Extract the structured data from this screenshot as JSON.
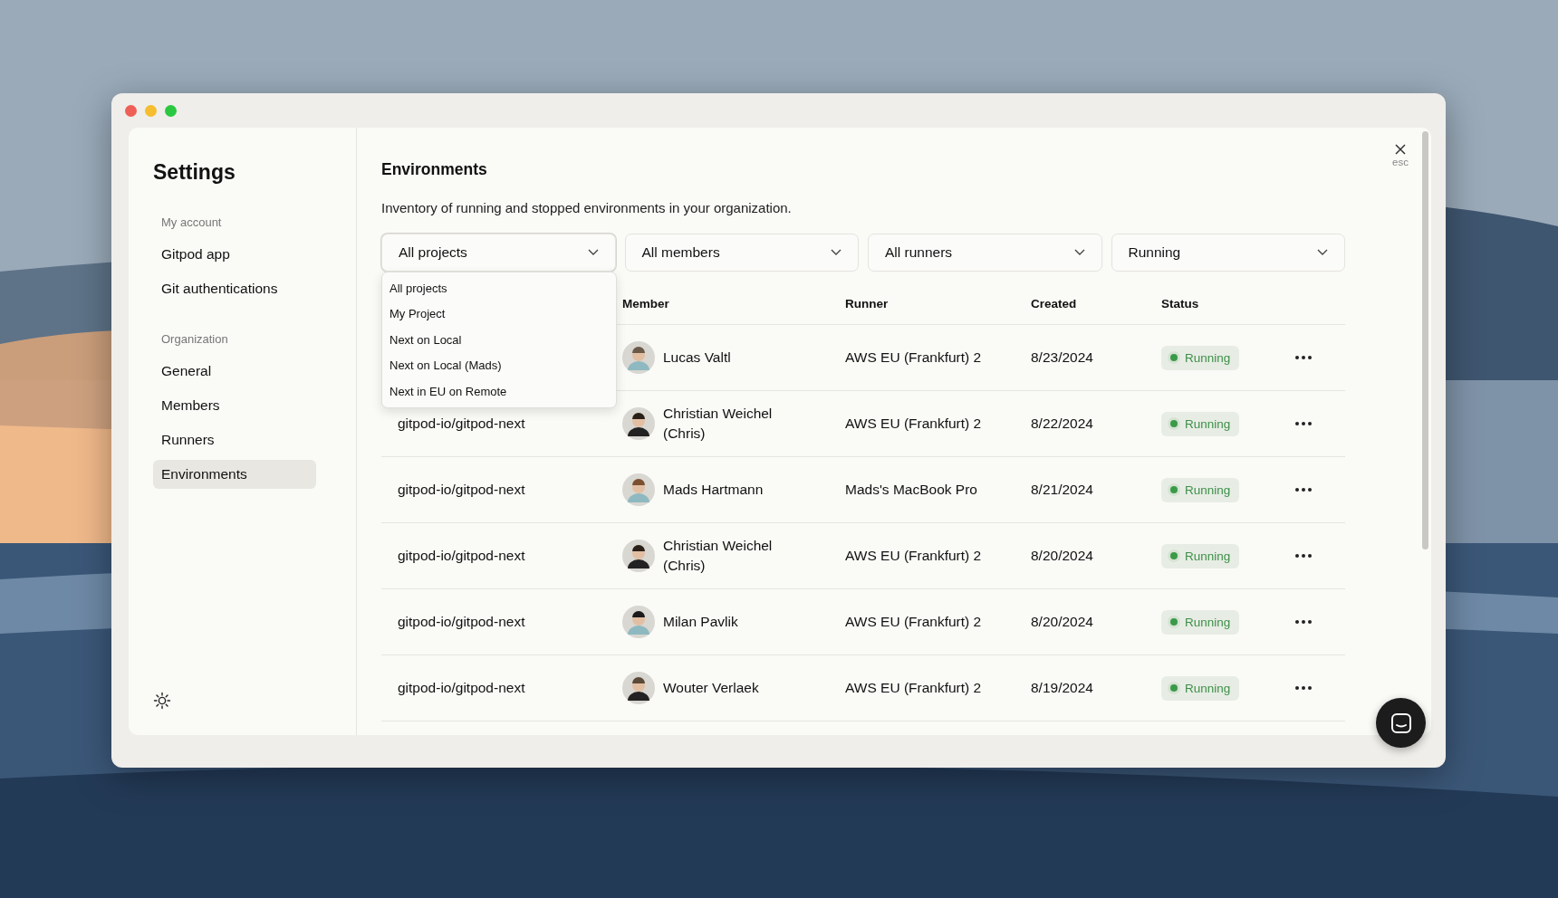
{
  "sidebar": {
    "title": "Settings",
    "sections": [
      {
        "heading": "My account",
        "items": [
          {
            "label": "Gitpod app",
            "selected": false
          },
          {
            "label": "Git authentications",
            "selected": false
          }
        ]
      },
      {
        "heading": "Organization",
        "items": [
          {
            "label": "General",
            "selected": false
          },
          {
            "label": "Members",
            "selected": false
          },
          {
            "label": "Runners",
            "selected": false
          },
          {
            "label": "Environments",
            "selected": true
          }
        ]
      }
    ]
  },
  "close": {
    "hint": "esc"
  },
  "main": {
    "title": "Environments",
    "description": "Inventory of running and stopped environments in your organization.",
    "filters": [
      {
        "label": "All projects",
        "open": true
      },
      {
        "label": "All members",
        "open": false
      },
      {
        "label": "All runners",
        "open": false
      },
      {
        "label": "Running",
        "open": false
      }
    ],
    "dropdown": {
      "options": [
        "All projects",
        "My Project",
        "Next on Local",
        "Next on Local (Mads)",
        "Next in EU on Remote"
      ]
    },
    "table": {
      "columns": [
        "Member",
        "Runner",
        "Created",
        "Status"
      ],
      "rows": [
        {
          "member": "Lucas Valtl",
          "runner": "AWS EU (Frankfurt) 2",
          "created": "8/23/2024",
          "status": "Running"
        },
        {
          "project": "gitpod-io/gitpod-next",
          "member": "Christian Weichel (Chris)",
          "runner": "AWS EU (Frankfurt) 2",
          "created": "8/22/2024",
          "status": "Running"
        },
        {
          "project": "gitpod-io/gitpod-next",
          "member": "Mads Hartmann",
          "runner": "Mads's MacBook Pro",
          "created": "8/21/2024",
          "status": "Running"
        },
        {
          "project": "gitpod-io/gitpod-next",
          "member": "Christian Weichel (Chris)",
          "runner": "AWS EU (Frankfurt) 2",
          "created": "8/20/2024",
          "status": "Running"
        },
        {
          "project": "gitpod-io/gitpod-next",
          "member": "Milan Pavlik",
          "runner": "AWS EU (Frankfurt) 2",
          "created": "8/20/2024",
          "status": "Running"
        },
        {
          "project": "gitpod-io/gitpod-next",
          "member": "Wouter Verlaek",
          "runner": "AWS EU (Frankfurt) 2",
          "created": "8/19/2024",
          "status": "Running"
        }
      ]
    }
  }
}
